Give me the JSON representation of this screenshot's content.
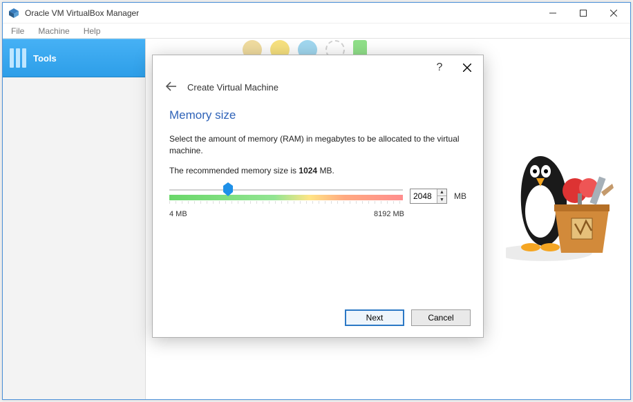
{
  "titlebar": {
    "title": "Oracle VM VirtualBox Manager"
  },
  "menubar": {
    "items": [
      "File",
      "Machine",
      "Help"
    ]
  },
  "sidebar": {
    "tools_label": "Tools"
  },
  "dialog": {
    "header": "Create Virtual Machine",
    "step_title": "Memory size",
    "description": "Select the amount of memory (RAM) in megabytes to be allocated to the virtual machine.",
    "recommended_prefix": "The recommended memory size is ",
    "recommended_value": "1024",
    "recommended_suffix": " MB.",
    "slider": {
      "min_label": "4 MB",
      "max_label": "8192 MB",
      "value": "2048",
      "unit": "MB",
      "min": 4,
      "max": 8192,
      "thumb_percent": 25
    },
    "buttons": {
      "next": "Next",
      "cancel": "Cancel"
    }
  }
}
